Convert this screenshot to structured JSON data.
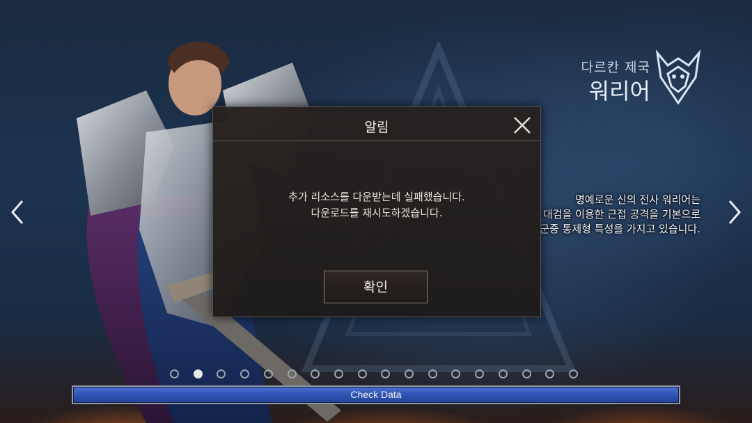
{
  "class_header": {
    "nation": "다르칸 제국",
    "name": "워리어"
  },
  "class_description": [
    "명예로운 신의 전사 워리어는",
    "양손 대검을 이용한 근접 공격을 기본으로",
    "군중 통제형 특성을 가지고 있습니다."
  ],
  "navigation": {
    "prev_icon": "chevron-left-icon",
    "next_icon": "chevron-right-icon"
  },
  "modal": {
    "title": "알림",
    "message_lines": [
      "추가 리소스를 다운받는데 실패했습니다.",
      "다운로드를 재시도하겠습니다."
    ],
    "confirm_label": "확인",
    "close_icon": "close-icon"
  },
  "pager": {
    "total": 18,
    "active_index": 1
  },
  "progress": {
    "label": "Check Data",
    "fraction": 1.0,
    "color": "#3a5fc4"
  }
}
